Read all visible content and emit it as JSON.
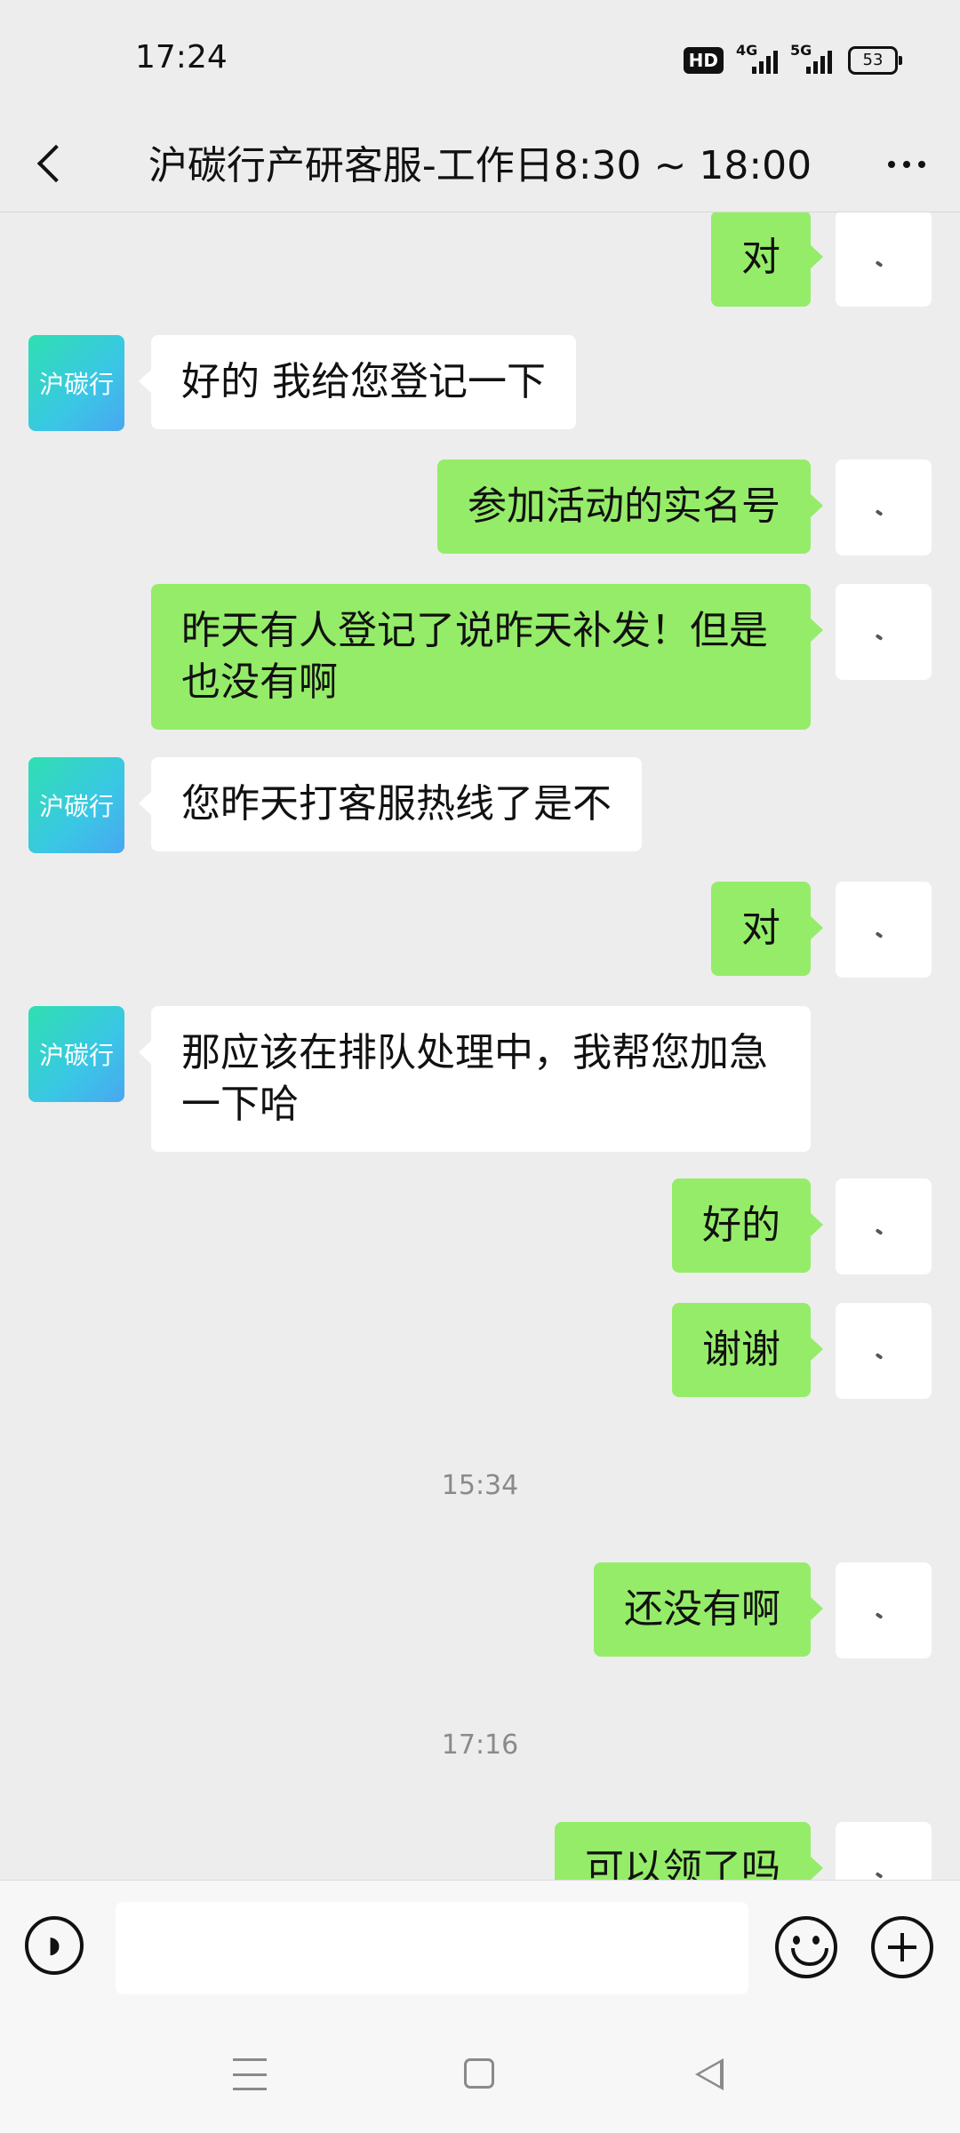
{
  "status_bar": {
    "time": "17:24",
    "hd": "HD",
    "net1": "4G",
    "net2": "5G",
    "battery": "53"
  },
  "header": {
    "title": "沪碳行产研客服-工作日8:30 ~ 18:00",
    "back_icon": "chevron-left-icon",
    "more_icon": "more-dots-icon"
  },
  "bot": {
    "avatar_text": "沪碳行"
  },
  "messages": [
    {
      "from": "me",
      "text": "对"
    },
    {
      "from": "bot",
      "text": "好的 我给您登记一下"
    },
    {
      "from": "me",
      "text": "参加活动的实名号"
    },
    {
      "from": "me",
      "text": "昨天有人登记了说昨天补发！但是也没有啊"
    },
    {
      "from": "bot",
      "text": "您昨天打客服热线了是不"
    },
    {
      "from": "me",
      "text": "对"
    },
    {
      "from": "bot",
      "text": "那应该在排队处理中，我帮您加急一下哈"
    },
    {
      "from": "me",
      "text": "好的"
    },
    {
      "from": "me",
      "text": "谢谢"
    },
    {
      "timestamp": "15:34"
    },
    {
      "from": "me",
      "text": "还没有啊"
    },
    {
      "timestamp": "17:16"
    },
    {
      "from": "me",
      "text": "可以领了吗"
    }
  ],
  "input_bar": {
    "value": "",
    "placeholder": "",
    "voice_icon": "voice-icon",
    "emoji_icon": "emoji-icon",
    "plus_icon": "plus-icon"
  },
  "colors": {
    "background": "#ededed",
    "sent_bubble": "#95ec69",
    "received_bubble": "#ffffff",
    "timestamp_text": "#8a8a8a"
  }
}
